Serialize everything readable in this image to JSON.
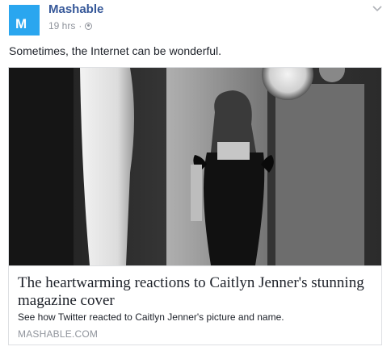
{
  "post": {
    "avatar_letter": "M",
    "page_name": "Mashable",
    "timestamp": "19 hrs",
    "separator": "·",
    "privacy_icon": "globe-icon",
    "options_icon": "chevron-down-icon",
    "status_text": "Sometimes, the Internet can be wonderful."
  },
  "attachment": {
    "title": "The heartwarming reactions to Caitlyn Jenner's stunning magazine cover",
    "description": "See how Twitter reacted to Caitlyn Jenner's picture and name.",
    "domain": "MASHABLE.COM"
  },
  "colors": {
    "avatar_bg": "#2aa6ef",
    "link_blue": "#365899",
    "meta_gray": "#90949c",
    "text": "#1d2129",
    "border": "#dddfe2"
  }
}
